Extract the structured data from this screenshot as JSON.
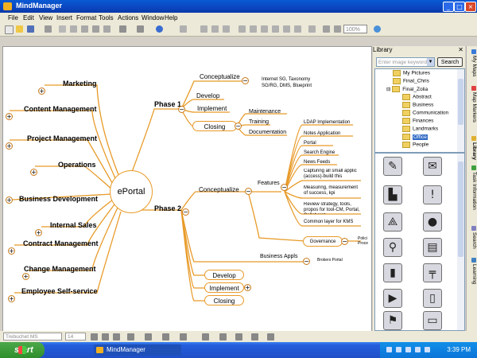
{
  "window": {
    "title": "MindManager"
  },
  "menu": [
    "File",
    "Edit",
    "View",
    "Insert",
    "Format",
    "Tools",
    "Actions",
    "Window",
    "Help"
  ],
  "toolbar": {
    "zoom": "100%"
  },
  "map": {
    "center": "ePortal",
    "left_topics": [
      "Marketing",
      "Content Management",
      "Project Management",
      "Operations",
      "Business Development",
      "Internal Sales",
      "Contract Management",
      "Change Management",
      "Employee Self-service"
    ],
    "phase1": {
      "label": "Phase 1",
      "conceptualize": "Conceptualize",
      "conceptualize_note": "Internet SG, Taxonomy SG/RG, DMS, Blueprint",
      "develop": "Develop",
      "implement": "Implement",
      "closing": "Closing",
      "closing_children": [
        "Maintenance",
        "Training",
        "Documentation"
      ]
    },
    "phase2": {
      "label": "Phase 2",
      "conceptualize": "Conceptualize",
      "features": "Features",
      "feature_items": [
        "LDAP Implementation",
        "Notes Application",
        "Portal",
        "Search Engine",
        "News Feeds",
        "Capturing all small applic (access)-build this",
        "Measuring, measurement of success, kpi",
        "Review strategy, tools, propos for tool-CM, Portal, Collaborat",
        "Common layer for KMS"
      ],
      "governance": "Governance",
      "governance_note": "Polici Proce",
      "business_appls": "Business Appls",
      "brokers_portal": "Brokers Portal",
      "develop": "Develop",
      "implement": "Implement",
      "closing": "Closing"
    }
  },
  "library": {
    "title": "Library",
    "search_placeholder": "Enter image keyword",
    "search_button": "Search",
    "tree": [
      "My Pictures",
      "Final_Chris",
      "Final_Zolia",
      "Abstract",
      "Business",
      "Communication",
      "Finances",
      "Landmarks",
      "Office",
      "People"
    ],
    "selected": "Office",
    "tiles": [
      "pen-icon",
      "envelope-icon",
      "stapler-icon",
      "exclamation-icon",
      "compass-icon",
      "globe-icon",
      "push-pin-icon",
      "calendar-icon",
      "glue-icon",
      "desk-icon",
      "tape-icon",
      "glass-icon",
      "lamp-icon",
      "mobile-icon",
      "paper-icon",
      "tray-icon"
    ]
  },
  "side_tabs": [
    "My Maps",
    "Map Markers",
    "Library",
    "Task Information",
    "Search",
    "Learning"
  ],
  "formatbar": {
    "font": "Trebuchet MS",
    "size": "14"
  },
  "taskbar": {
    "start": "start",
    "task": "MindManager",
    "clock": "3:39 PM"
  }
}
